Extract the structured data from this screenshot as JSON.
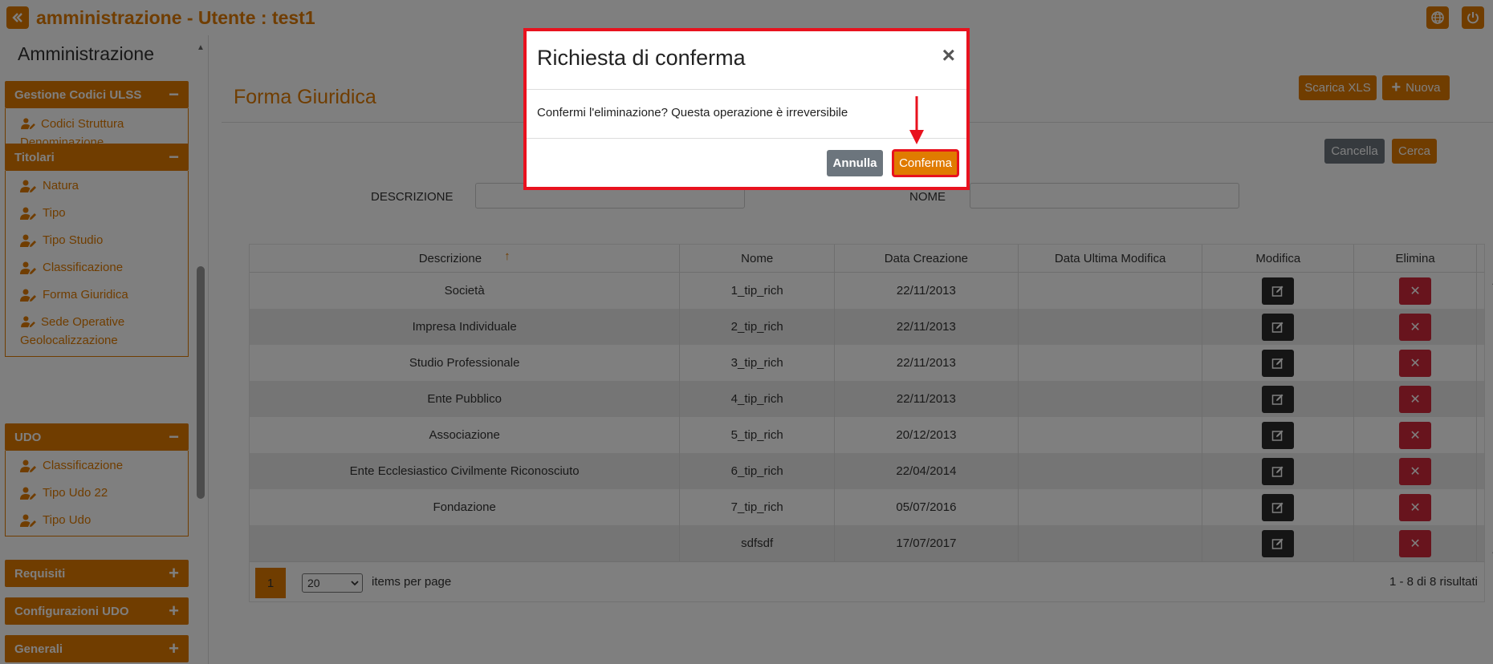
{
  "topbar": {
    "title": "amministrazione - Utente : test1"
  },
  "sidebar": {
    "title": "Amministrazione",
    "sections": [
      {
        "label": "Gestione Codici ULSS",
        "toggle": "−",
        "items": [
          "Codici Struttura Denominazione"
        ]
      },
      {
        "label": "Titolari",
        "toggle": "−",
        "items": [
          "Natura",
          "Tipo",
          "Tipo Studio",
          "Classificazione",
          "Forma Giuridica",
          "Sede Operative Geolocalizzazione"
        ]
      },
      {
        "label": "UDO",
        "toggle": "−",
        "items": [
          "Classificazione",
          "Tipo Udo 22",
          "Tipo Udo"
        ]
      },
      {
        "label": "Requisiti",
        "toggle": "+"
      },
      {
        "label": "Configurazioni UDO",
        "toggle": "+"
      },
      {
        "label": "Generali",
        "toggle": "+"
      }
    ]
  },
  "main": {
    "page_title": "Forma Giuridica",
    "buttons": {
      "xls": "Scarica XLS",
      "nuova": "Nuova",
      "cancella": "Cancella",
      "cerca": "Cerca"
    },
    "filters": {
      "descrizione": "DESCRIZIONE",
      "nome": "NOME"
    },
    "table": {
      "headers": [
        "Descrizione",
        "Nome",
        "Data Creazione",
        "Data Ultima Modifica",
        "Modifica",
        "Elimina"
      ],
      "sort_indicator": "↑",
      "rows": [
        [
          "Società",
          "1_tip_rich",
          "22/11/2013",
          ""
        ],
        [
          "Impresa Individuale",
          "2_tip_rich",
          "22/11/2013",
          ""
        ],
        [
          "Studio Professionale",
          "3_tip_rich",
          "22/11/2013",
          ""
        ],
        [
          "Ente Pubblico",
          "4_tip_rich",
          "22/11/2013",
          ""
        ],
        [
          "Associazione",
          "5_tip_rich",
          "20/12/2013",
          ""
        ],
        [
          "Ente Ecclesiastico Civilmente Riconosciuto",
          "6_tip_rich",
          "22/04/2014",
          ""
        ],
        [
          "Fondazione",
          "7_tip_rich",
          "05/07/2016",
          ""
        ],
        [
          "",
          "sdfsdf",
          "17/07/2017",
          ""
        ]
      ]
    },
    "pagination": {
      "page": "1",
      "per_page": "20",
      "per_page_label": "items per page",
      "results": "1 - 8 di 8 risultati"
    }
  },
  "modal": {
    "title": "Richiesta di conferma",
    "close": "×",
    "message": "Confermi l'eliminazione? Questa operazione è irreversibile",
    "cancel_label": "Annulla",
    "confirm_label": "Conferma"
  },
  "colors": {
    "accent": "#e07b00",
    "danger": "#d1293a",
    "highlight": "#e8121e"
  }
}
